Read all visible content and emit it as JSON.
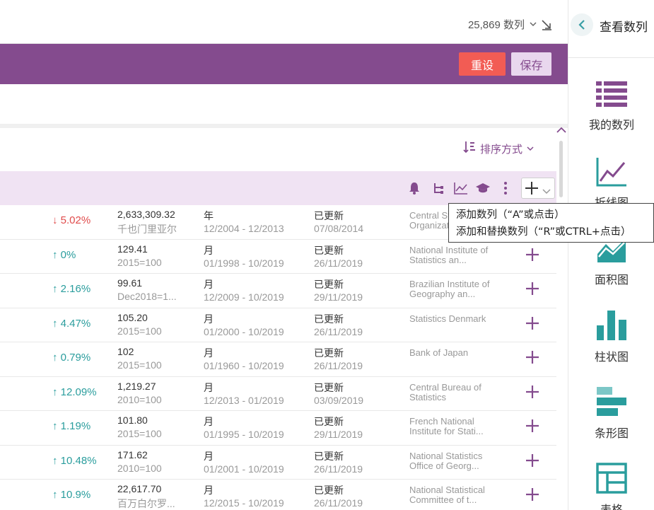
{
  "topbar": {
    "series_count": "25,869 数列"
  },
  "actions": {
    "reset_label": "重设",
    "save_label": "保存"
  },
  "table": {
    "sort_label": "排序方式",
    "rows": [
      {
        "change": "↓ 5.02%",
        "direction": "down",
        "value": "2,633,309.32",
        "unit": "千也门里亚尔",
        "frequency": "年",
        "range": "12/2004 - 12/2013",
        "status": "已更新",
        "date": "07/08/2014",
        "source": "Central Statistical Organization"
      },
      {
        "change": "↑ 0%",
        "direction": "up",
        "value": "129.41",
        "unit": "2015=100",
        "frequency": "月",
        "range": "01/1998 - 10/2019",
        "status": "已更新",
        "date": "26/11/2019",
        "source": "National Institute of Statistics an..."
      },
      {
        "change": "↑ 2.16%",
        "direction": "up",
        "value": "99.61",
        "unit": "Dec2018=1...",
        "frequency": "月",
        "range": "12/2009 - 10/2019",
        "status": "已更新",
        "date": "29/11/2019",
        "source": "Brazilian Institute of Geography an..."
      },
      {
        "change": "↑ 4.47%",
        "direction": "up",
        "value": "105.20",
        "unit": "2015=100",
        "frequency": "月",
        "range": "01/2000 - 10/2019",
        "status": "已更新",
        "date": "26/11/2019",
        "source": "Statistics Denmark"
      },
      {
        "change": "↑ 0.79%",
        "direction": "up",
        "value": "102",
        "unit": "2015=100",
        "frequency": "月",
        "range": "01/1960 - 10/2019",
        "status": "已更新",
        "date": "26/11/2019",
        "source": "Bank of Japan"
      },
      {
        "change": "↑ 12.09%",
        "direction": "up",
        "value": "1,219.27",
        "unit": "2010=100",
        "frequency": "月",
        "range": "12/2013 - 01/2019",
        "status": "已更新",
        "date": "03/09/2019",
        "source": "Central Bureau of Statistics"
      },
      {
        "change": "↑ 1.19%",
        "direction": "up",
        "value": "101.80",
        "unit": "2015=100",
        "frequency": "月",
        "range": "01/1995 - 10/2019",
        "status": "已更新",
        "date": "29/11/2019",
        "source": "French National Institute for Stati..."
      },
      {
        "change": "↑ 10.48%",
        "direction": "up",
        "value": "171.62",
        "unit": "2010=100",
        "frequency": "月",
        "range": "01/2001 - 10/2019",
        "status": "已更新",
        "date": "26/11/2019",
        "source": "National Statistics Office of Georg..."
      },
      {
        "change": "↑ 10.9%",
        "direction": "up",
        "value": "22,617.70",
        "unit": "百万白尔罗...",
        "frequency": "月",
        "range": "12/2015 - 10/2019",
        "status": "已更新",
        "date": "26/11/2019",
        "source": "National Statistical Committee of t..."
      }
    ]
  },
  "tooltip": {
    "line1": "添加数列（“A”或点击）",
    "line2": "添加和替换数列（“R”或CTRL+点击）"
  },
  "right_panel": {
    "title": "查看数列",
    "items": [
      {
        "label": "我的数列",
        "icon": "list-icon"
      },
      {
        "label": "折线图",
        "icon": "line-chart-icon"
      },
      {
        "label": "面积图",
        "icon": "area-chart-icon"
      },
      {
        "label": "柱状图",
        "icon": "column-chart-icon"
      },
      {
        "label": "条形图",
        "icon": "bar-chart-icon"
      },
      {
        "label": "表格",
        "icon": "table-icon"
      }
    ]
  },
  "colors": {
    "brand": "#844b8e",
    "accent": "#2a9d9d",
    "danger": "#f25c54",
    "down": "#e04b4b"
  }
}
